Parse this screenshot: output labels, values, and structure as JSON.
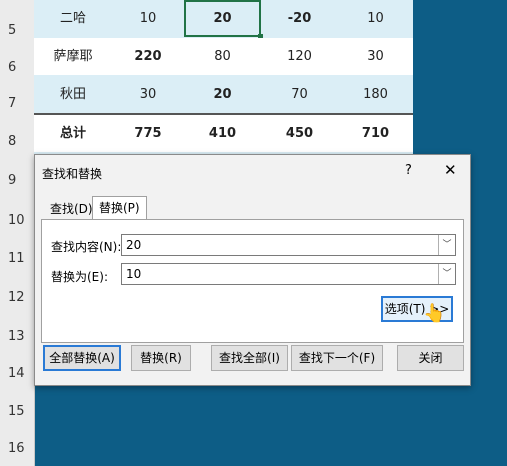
{
  "row_numbers": [
    "5",
    "6",
    "7",
    "8",
    "9",
    "10",
    "11",
    "12",
    "13",
    "14",
    "15",
    "16"
  ],
  "sheet": {
    "rows": [
      {
        "name": "二哈",
        "v1": "10",
        "v2": "20",
        "v3": "-20",
        "v4": "10"
      },
      {
        "name": "萨摩耶",
        "v1": "220",
        "v2": "80",
        "v3": "120",
        "v4": "30"
      },
      {
        "name": "秋田",
        "v1": "30",
        "v2": "20",
        "v3": "70",
        "v4": "180"
      },
      {
        "name": "总计",
        "v1": "775",
        "v2": "410",
        "v3": "450",
        "v4": "710"
      }
    ]
  },
  "dialog": {
    "title": "查找和替换",
    "help": "?",
    "close": "✕",
    "tabs": [
      {
        "label": "查找(D)"
      },
      {
        "label": "替换(P)"
      }
    ],
    "find_label": "查找内容(N):",
    "find_value": "20",
    "replace_label": "替换为(E):",
    "replace_value": "10",
    "dropdown_glyph": "﹀",
    "options_button": "选项(T) >>",
    "buttons": {
      "replace_all": "全部替换(A)",
      "replace": "替换(R)",
      "find_all": "查找全部(I)",
      "find_next": "查找下一个(F)",
      "close": "关闭"
    }
  },
  "colors": {
    "accent": "#2a7ad5",
    "red": "#c00000",
    "sheet_bg": "#dbeef6",
    "backdrop": "#0d5d86",
    "selection": "#217346"
  }
}
